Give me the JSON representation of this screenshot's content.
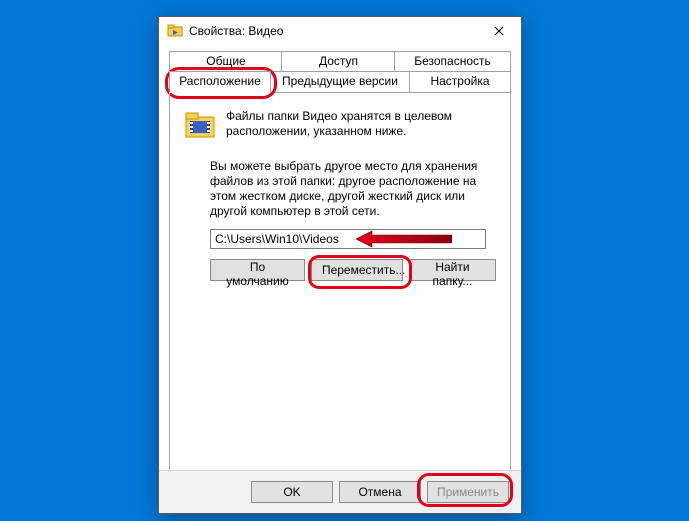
{
  "window": {
    "title": "Свойства: Видео"
  },
  "tabs": {
    "row1": [
      "Общие",
      "Доступ",
      "Безопасность"
    ],
    "row2": [
      "Расположение",
      "Предыдущие версии",
      "Настройка"
    ],
    "active": "Расположение"
  },
  "body": {
    "desc": "Файлы папки Видео хранятся в целевом расположении, указанном ниже.",
    "para": "Вы можете выбрать другое место для хранения файлов из этой папки: другое расположение на этом жестком диске, другой жесткий диск или другой компьютер в этой сети.",
    "path": "C:\\Users\\Win10\\Videos"
  },
  "buttons": {
    "restore": "По умолчанию",
    "move": "Переместить...",
    "find": "Найти папку..."
  },
  "footer": {
    "ok": "OK",
    "cancel": "Отмена",
    "apply": "Применить"
  },
  "highlight_color": "#e2001a"
}
